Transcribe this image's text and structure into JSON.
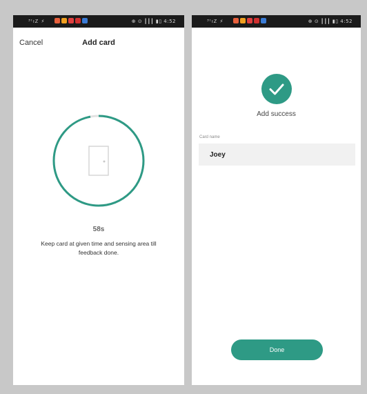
{
  "status_bar": {
    "signal_text": "³ᵗıᏃ ⚡",
    "status_right": "⊕ ⊙ ┃┃┃ ▮▯ 4:52",
    "app_colors": [
      "#e8603c",
      "#f0a020",
      "#e04040",
      "#d03030",
      "#3a7bd5"
    ]
  },
  "add_card_screen": {
    "cancel_label": "Cancel",
    "title": "Add card",
    "countdown": "58s",
    "instruction": "Keep card at given time and sensing area till feedback done.",
    "progress_fraction": 0.97
  },
  "success_screen": {
    "success_text": "Add success",
    "card_name_label": "Card name",
    "card_name_value": "Joey",
    "done_label": "Done"
  },
  "colors": {
    "accent": "#2e9a85",
    "field_bg": "#f1f1f1",
    "frame": "#c8c8c8"
  }
}
